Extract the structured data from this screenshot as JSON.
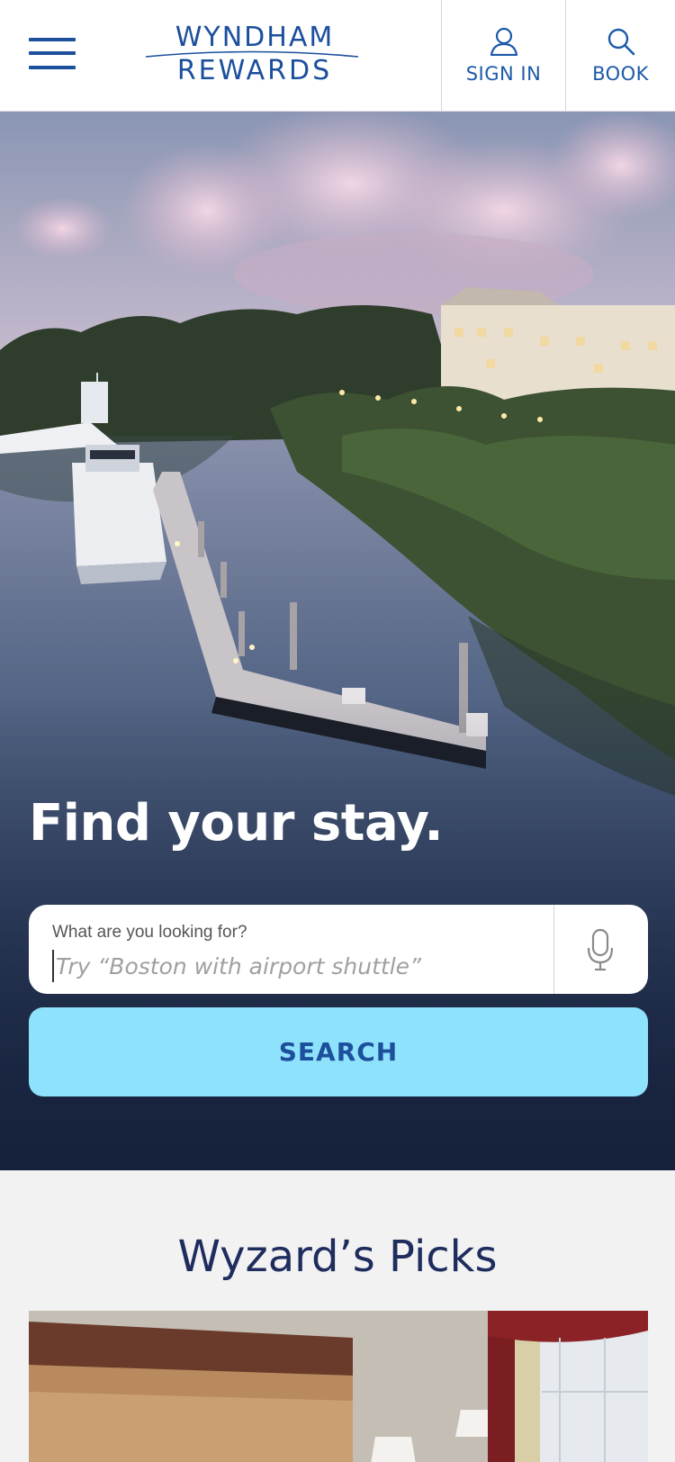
{
  "header": {
    "menu_icon": "hamburger-menu-icon",
    "logo": {
      "line1": "WYNDHAM",
      "line2": "REWARDS"
    },
    "sign_in": {
      "label": "SIGN IN",
      "icon": "user-icon"
    },
    "book": {
      "label": "BOOK",
      "icon": "search-icon"
    },
    "brand_color": "#1c4f9c"
  },
  "hero": {
    "title": "Find your stay.",
    "search": {
      "label": "What are you looking for?",
      "placeholder": "Try “Boston with airport shuttle”",
      "mic_icon": "microphone-icon"
    },
    "search_button": {
      "label": "SEARCH",
      "color": "#8fe2fc"
    }
  },
  "picks": {
    "title": "Wyzard’s Picks"
  }
}
